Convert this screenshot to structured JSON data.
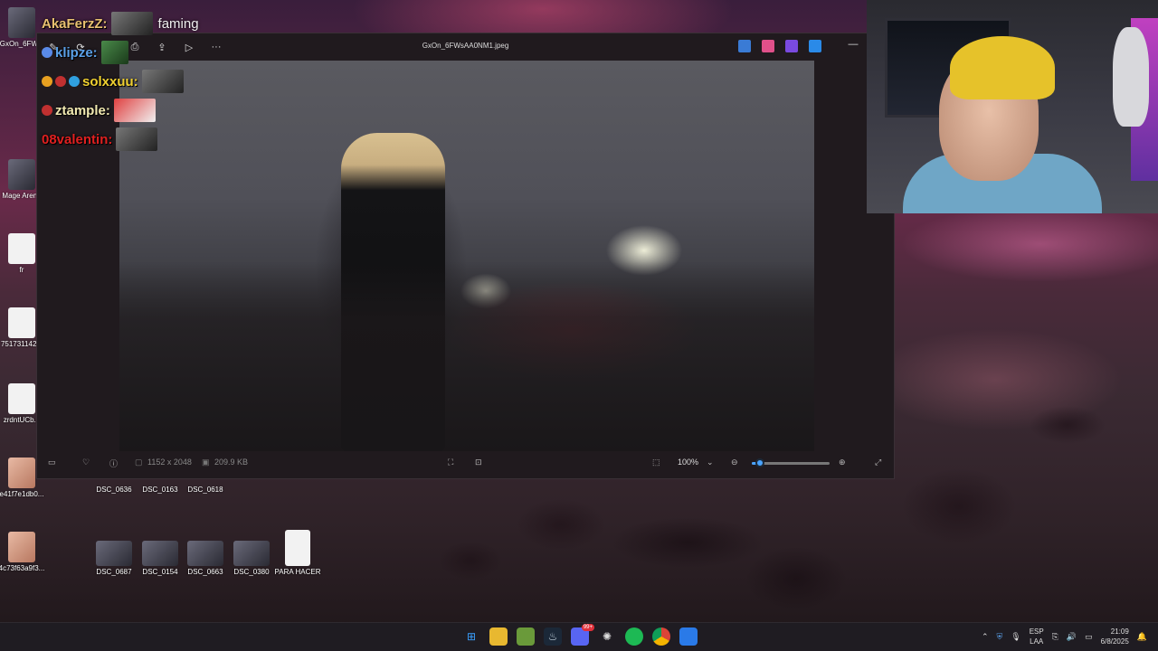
{
  "chat": [
    {
      "user": "AkaFerzZ:",
      "color": "#e8c070",
      "message": "faming"
    },
    {
      "user": "klipze:",
      "color": "#5aa0e8",
      "message": ""
    },
    {
      "user": "solxxuu:",
      "color": "#f0d030",
      "message": ""
    },
    {
      "user": "ztample:",
      "color": "#f0e8b0",
      "message": ""
    },
    {
      "user": "08valentin:",
      "color": "#e02020",
      "message": ""
    }
  ],
  "desktop_left": [
    {
      "label": "GxOn_6FW..."
    },
    {
      "label": "Mage Arena"
    },
    {
      "label": "fr"
    },
    {
      "label": "751731142..."
    },
    {
      "label": "zrdntUCb..."
    },
    {
      "label": "e41f7e1db0..."
    },
    {
      "label": "4c73f63a9f3..."
    }
  ],
  "desktop_files": [
    {
      "label": "DSC_0636"
    },
    {
      "label": "DSC_0163"
    },
    {
      "label": "DSC_0618"
    },
    {
      "label": "DSC_0687"
    },
    {
      "label": "DSC_0154"
    },
    {
      "label": "DSC_0663"
    },
    {
      "label": "DSC_0380"
    },
    {
      "label": "PARA HACER"
    }
  ],
  "viewer": {
    "title": "GxOn_6FWsAA0NM1.jpeg",
    "dimensions": "1152 x 2048",
    "file_size": "209.9 KB",
    "zoom": "100%",
    "zoom_level": 0.1
  },
  "taskbar": {
    "language": "ESP",
    "region": "LAA",
    "time": "21:09",
    "date": "6/8/2025",
    "badge": "99+"
  },
  "colors": {
    "accent": "#4aa3ff",
    "taskbar_bg": "#1f1c22"
  }
}
